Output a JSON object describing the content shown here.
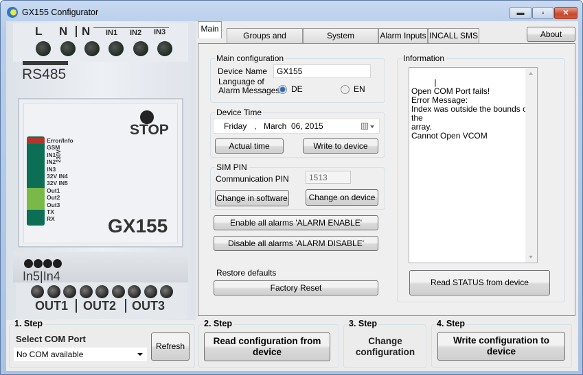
{
  "window": {
    "title": "GX155 Configurator",
    "controls": {
      "minimize": "–",
      "maximize": "□",
      "close": "✕"
    }
  },
  "device_image": {
    "top_terminals": [
      "L",
      "N",
      "N",
      "IN1",
      "IN2",
      "IN3"
    ],
    "rs485": "RS485",
    "stop": "STOP",
    "model": "GX155",
    "voltage": "230V",
    "leds": [
      {
        "label": "Error/Info",
        "color": "#b3342a"
      },
      {
        "label": "GSM",
        "color": "#0c6e55"
      },
      {
        "label": "IN1",
        "color": "#0c6e55"
      },
      {
        "label": "IN2",
        "color": "#0c6e55"
      },
      {
        "label": "IN3",
        "color": "#0c6e55"
      },
      {
        "label": "32V IN4",
        "color": "#0c6e55"
      },
      {
        "label": "32V IN5",
        "color": "#0c6e55"
      },
      {
        "label": "Out1",
        "color": "#7ab847"
      },
      {
        "label": "Out2",
        "color": "#7ab847"
      },
      {
        "label": "Out3",
        "color": "#7ab847"
      },
      {
        "label": "TX",
        "color": "#0c6e55"
      },
      {
        "label": "RX",
        "color": "#0c6e55"
      }
    ],
    "in_label": "In5|In4",
    "out_labels": [
      "OUT1",
      "OUT2",
      "OUT3"
    ]
  },
  "tabs": [
    {
      "label": "Main",
      "active": true
    },
    {
      "label": "Groups and Contacts",
      "active": false
    },
    {
      "label": "System configuration",
      "active": false
    },
    {
      "label": "Alarm Inputs",
      "active": false
    },
    {
      "label": "INCALL SMS",
      "active": false
    }
  ],
  "about_label": "About",
  "main_config": {
    "title": "Main configuration",
    "device_name_label": "Device Name",
    "device_name_value": "GX155",
    "language_label_1": "Language of",
    "language_label_2": "Alarm Messages",
    "language_options": [
      {
        "label": "DE",
        "checked": true
      },
      {
        "label": "EN",
        "checked": false
      }
    ]
  },
  "device_time": {
    "title": "Device Time",
    "day": "Friday",
    "sep": ",",
    "month": "March",
    "date": "06, 2015",
    "actual_time_label": "Actual time",
    "write_label": "Write to device"
  },
  "sim_pin": {
    "title": "SIM PIN",
    "pin_label": "Communication PIN",
    "pin_value": "1513",
    "change_software_label": "Change in software",
    "change_device_label": "Change on device"
  },
  "alarms": {
    "enable_label": "Enable all alarms 'ALARM ENABLE'",
    "disable_label": "Disable all alarms 'ALARM DISABLE'"
  },
  "restore": {
    "label": "Restore defaults",
    "factory_reset_label": "Factory Reset"
  },
  "information": {
    "title": "Information",
    "text": "|\nOpen COM Port fails!\nError Message:\nIndex was outside the bounds of the\narray.\nCannot Open VCOM",
    "read_status_label": "Read STATUS from device"
  },
  "steps": {
    "step1": {
      "title": "1. Step",
      "label": "Select COM Port",
      "com_value": "No COM available",
      "refresh_label": "Refresh"
    },
    "step2": {
      "title": "2. Step",
      "button_label": "Read configuration from device"
    },
    "step3": {
      "title": "3. Step",
      "text": "Change configuration"
    },
    "step4": {
      "title": "4. Step",
      "button_label": "Write configuration to device"
    }
  }
}
